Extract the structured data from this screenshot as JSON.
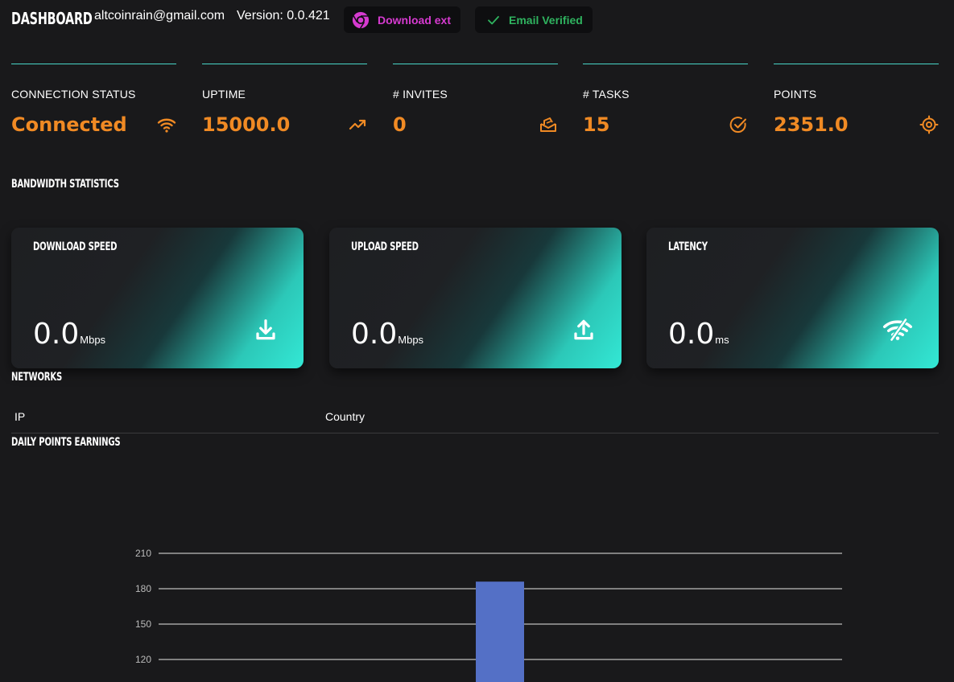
{
  "header": {
    "brand": "DASHBOARD",
    "email": "altcoinrain@gmail.com",
    "version": "Version: 0.0.421",
    "download_label": "Download ext",
    "verified_label": "Email Verified"
  },
  "stats": [
    {
      "label": "CONNECTION STATUS",
      "value": "Connected",
      "icon": "wifi-icon"
    },
    {
      "label": "UPTIME",
      "value": "15000.0",
      "icon": "trending-up-icon"
    },
    {
      "label": "# INVITES",
      "value": "0",
      "icon": "invites-icon"
    },
    {
      "label": "# TASKS",
      "value": "15",
      "icon": "check-circle-icon"
    },
    {
      "label": "POINTS",
      "value": "2351.0",
      "icon": "target-icon"
    }
  ],
  "bandwidth": {
    "title": "BANDWIDTH STATISTICS",
    "cards": [
      {
        "title": "DOWNLOAD SPEED",
        "value": "0.0",
        "unit": "Mbps",
        "icon": "download-icon"
      },
      {
        "title": "UPLOAD SPEED",
        "value": "0.0",
        "unit": "Mbps",
        "icon": "upload-icon"
      },
      {
        "title": "LATENCY",
        "value": "0.0",
        "unit": "ms",
        "icon": "wifi-off-icon"
      }
    ]
  },
  "networks": {
    "title": "NETWORKS",
    "columns": [
      "IP",
      "Country"
    ]
  },
  "daily": {
    "title": "DAILY POINTS EARNINGS"
  },
  "colors": {
    "accent_orange": "#f08a24",
    "accent_teal": "#47d6c8",
    "download_pink": "#d63ad0",
    "verified_green": "#2fb35f",
    "bar_blue": "#5470c6"
  },
  "chart_data": {
    "type": "bar",
    "title": "",
    "xlabel": "",
    "ylabel": "",
    "y_ticks": [
      120,
      150,
      180,
      210
    ],
    "ylim": [
      0,
      210
    ],
    "grid": true,
    "series": [
      {
        "values": [
          186
        ]
      }
    ]
  }
}
